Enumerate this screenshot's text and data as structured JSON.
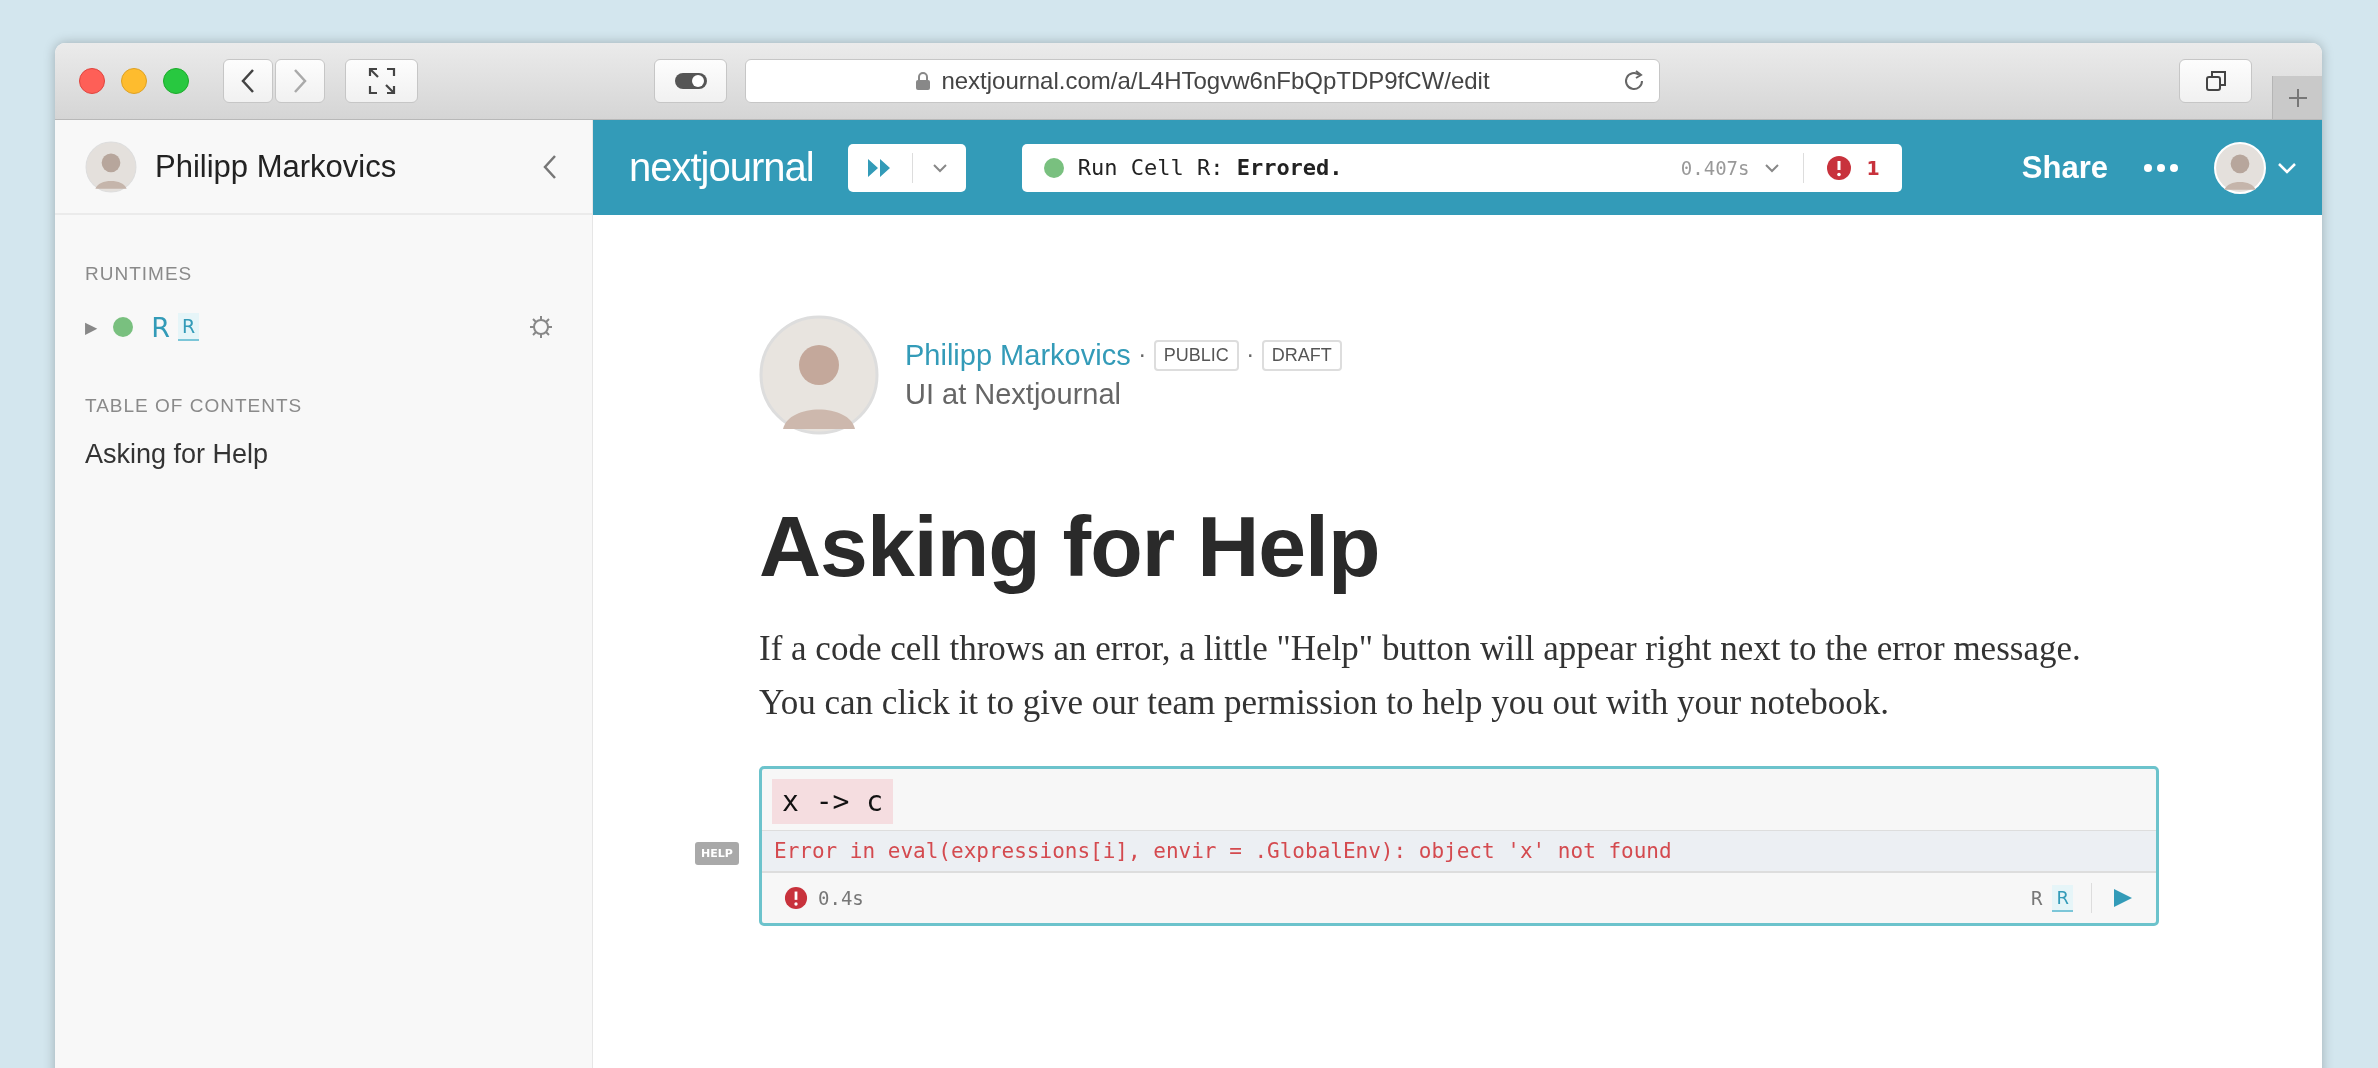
{
  "browser": {
    "url": "nextjournal.com/a/L4HTogvw6nFbQpTDP9fCW/edit"
  },
  "sidebar": {
    "user": "Philipp Markovics",
    "runtimes_label": "RUNTIMES",
    "runtimes": [
      {
        "expand": "▶",
        "color": "#79c07f",
        "name": "R",
        "badge": "R"
      }
    ],
    "toc_label": "TABLE OF CONTENTS",
    "toc": [
      {
        "label": "Asking for Help"
      }
    ]
  },
  "toolbar": {
    "logo": "nextjournal",
    "status": "Run Cell R: **Errored.**",
    "time": "0.407s",
    "error_count": "1",
    "share": "Share"
  },
  "article": {
    "author": "Philipp Markovics",
    "tags": [
      {
        "separator": "·",
        "label": "PUBLIC"
      },
      {
        "separator": "·",
        "label": "DRAFT"
      }
    ],
    "subtitle": "UI at Nextjournal",
    "title": "Asking for Help",
    "paragraph": "If a code cell throws an error, a little \"Help\" button will appear right next to the error message. You can click it to give our team permission to help you out with your notebook.",
    "cell": {
      "help": "HELP",
      "code": "x -> c",
      "error": "Error in eval(expressions[i], envir = .GlobalEnv): object 'x' not found",
      "time": "0.4s",
      "runtime": "R",
      "badge": "R"
    }
  }
}
